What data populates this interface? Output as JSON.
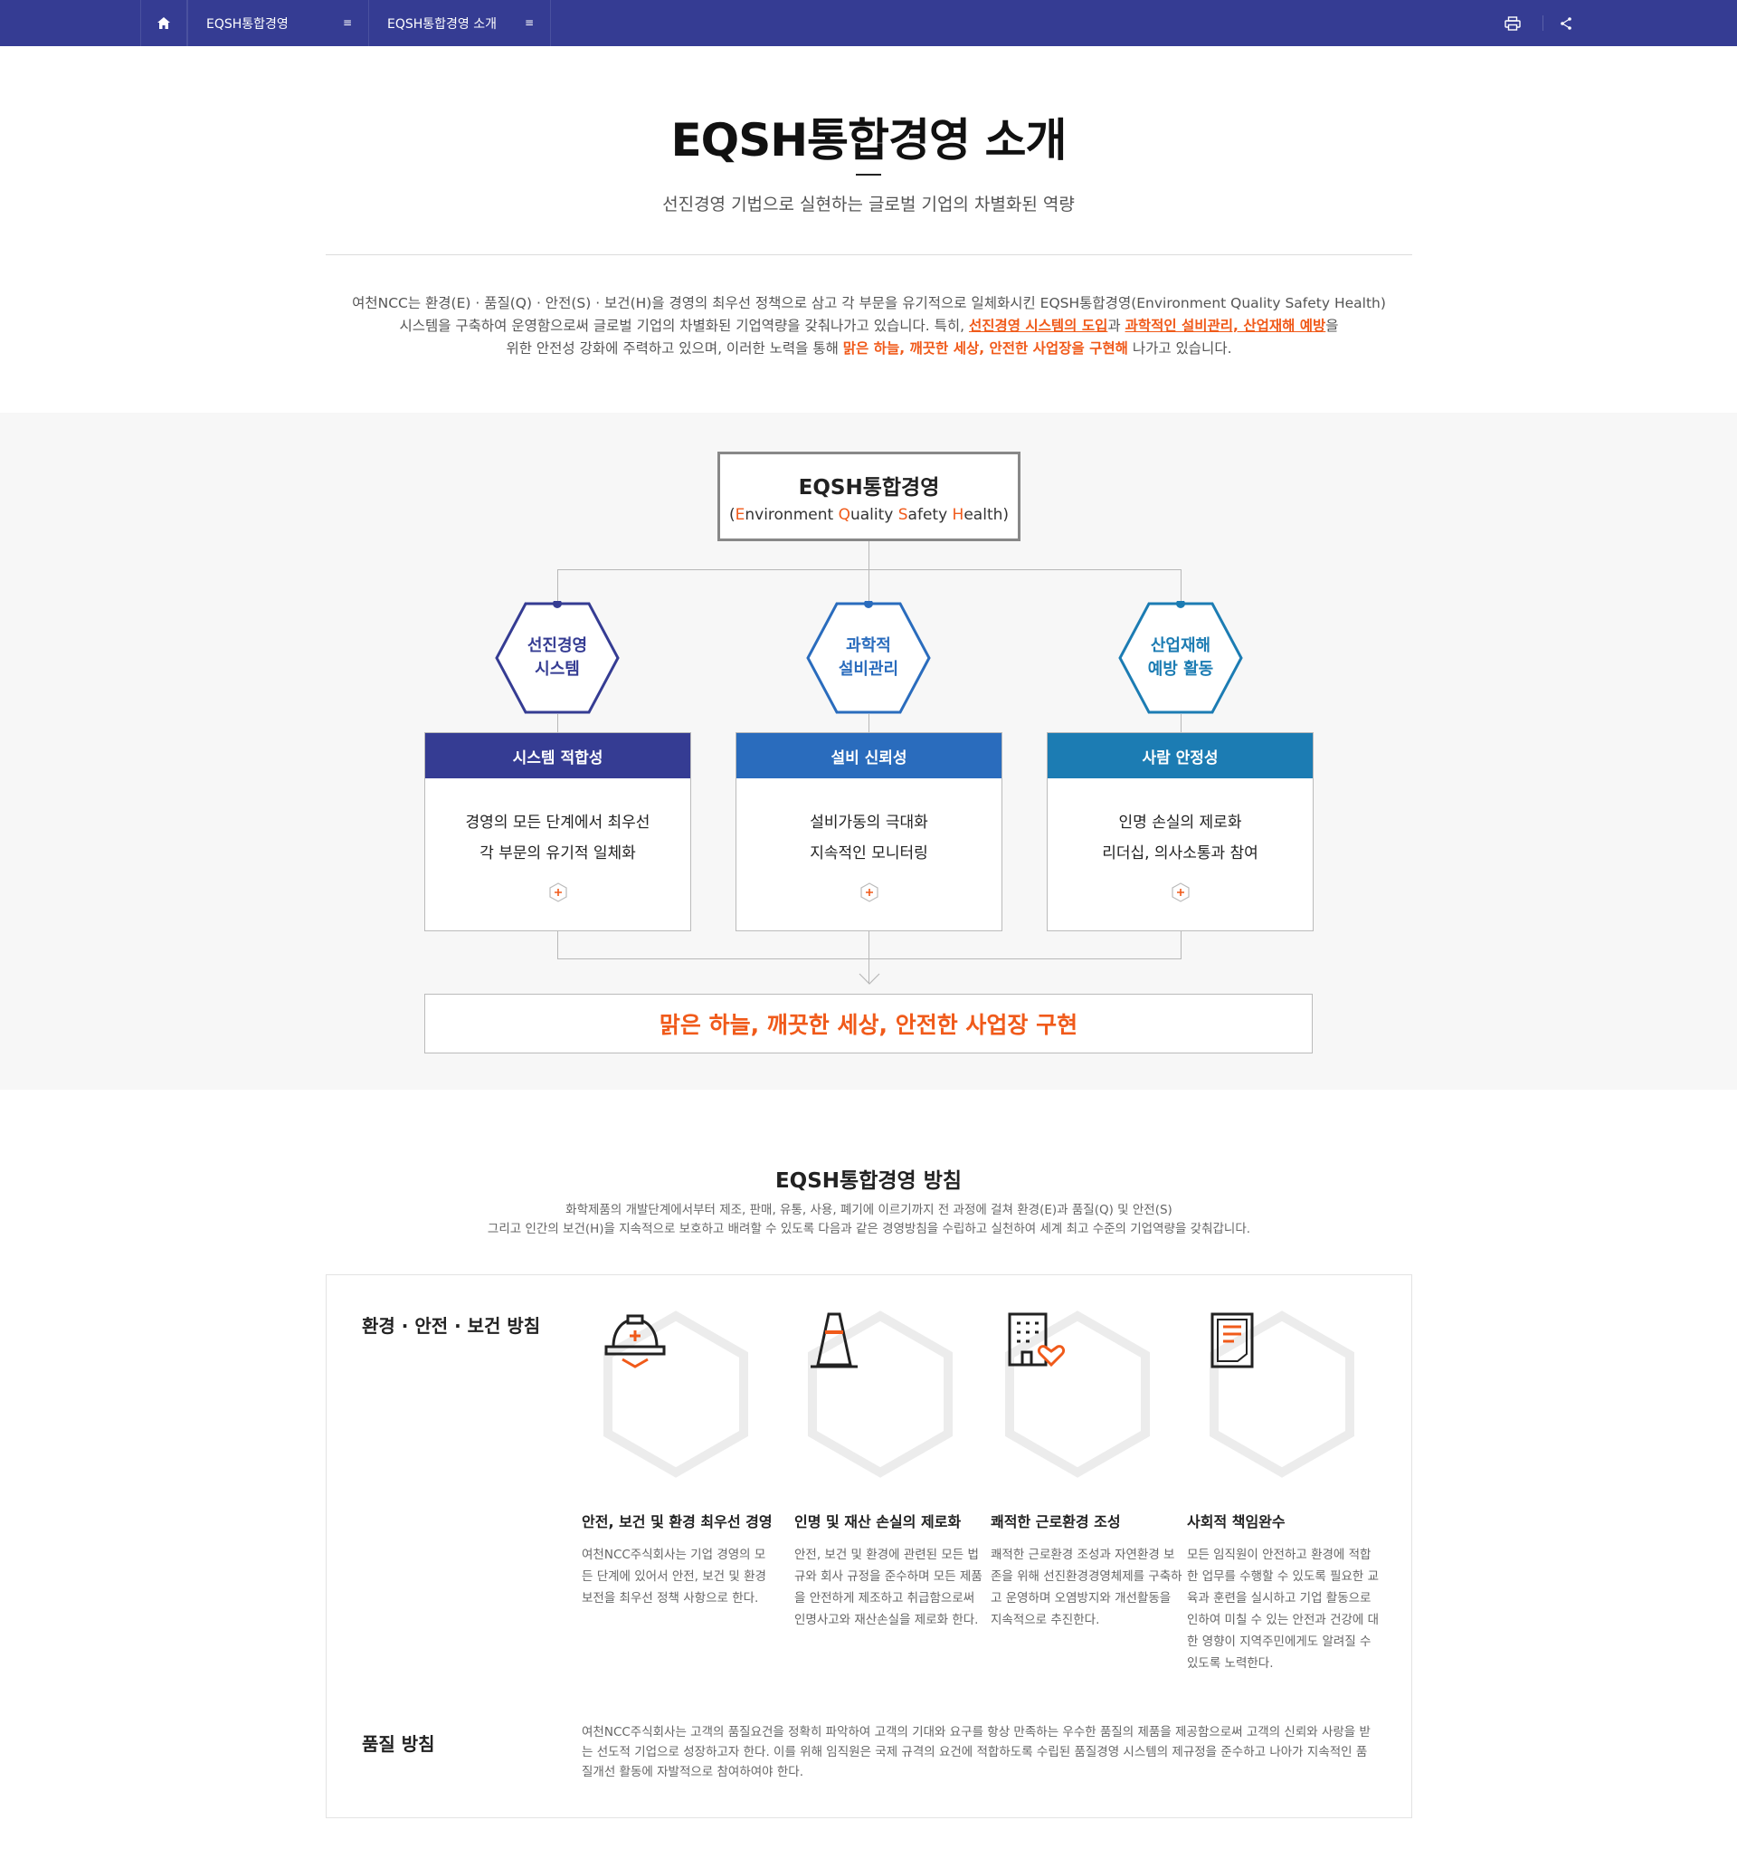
{
  "nav": {
    "crumb1": "EQSH통합경영",
    "crumb2": "EQSH통합경영 소개",
    "menu_glyph": "≡"
  },
  "header": {
    "title": "EQSH통합경영 소개",
    "subtitle": "선진경영 기법으로 실현하는 글로벌 기업의 차별화된 역량"
  },
  "intro": {
    "line1": "여천NCC는 환경(E) · 품질(Q) · 안전(S) · 보건(H)을 경영의 최우선 정책으로 삼고 각 부문을 유기적으로 일체화시킨 EQSH통합경영(Environment Quality Safety Health)",
    "line2_a": "시스템을 구축하여 운영함으로써 글로벌 기업의 차별화된 기업역량을 갖춰나가고 있습니다. 특히, ",
    "line2_hl1": "선진경영 시스템의 도입",
    "line2_b": "과 ",
    "line2_hl2": "과학적인 설비관리, 산업재해 예방",
    "line2_c": "을",
    "line3_a": "위한 안전성 강화에 주력하고 있으며, 이러한 노력을 통해 ",
    "line3_hl": "맑은 하늘, 깨끗한 세상, 안전한 사업장을 구현해",
    "line3_b": " 나가고 있습니다."
  },
  "diagram": {
    "top_title": "EQSH통합경영",
    "top_sub_parts": [
      "(",
      "E",
      "nvironment ",
      "Q",
      "uality ",
      "S",
      "afety ",
      "H",
      "ealth)"
    ],
    "pillars": [
      {
        "hex": "선진경영\n시스템",
        "head": "시스템 적합성",
        "line1": "경영의 모든 단계에서 최우선",
        "line2": "각 부문의 유기적 일체화",
        "color": "#353c93"
      },
      {
        "hex": "과학적\n설비관리",
        "head": "설비 신뢰성",
        "line1": "설비가동의 극대화",
        "line2": "지속적인 모니터링",
        "color": "#2a6cbd"
      },
      {
        "hex": "산업재해\n예방 활동",
        "head": "사람 안정성",
        "line1": "인명 손실의 제로화",
        "line2": "리더십, 의사소통과 참여",
        "color": "#1c7cb3"
      }
    ],
    "result": "맑은 하늘, 깨끗한 세상, 안전한 사업장 구현"
  },
  "policy": {
    "title": "EQSH통합경영 방침",
    "desc1": "화학제품의 개발단계에서부터 제조, 판매, 유통, 사용, 폐기에 이르기까지 전 과정에 걸쳐 환경(E)과 품질(Q) 및 안전(S)",
    "desc2": "그리고 인간의 보건(H)을 지속적으로 보호하고 배려할 수 있도록 다음과 같은 경영방침을 수립하고 실천하여 세계 최고 수준의 기업역량을 갖춰갑니다.",
    "env_title": "환경 · 안전 · 보건 방침",
    "items": [
      {
        "title": "안전, 보건 및 환경 최우선 경영",
        "body": "여천NCC주식회사는 기업 경영의 모든 단계에 있어서 안전, 보건 및 환경보전을 최우선 정책 사항으로 한다."
      },
      {
        "title": "인명 및 재산 손실의 제로화",
        "body": "안전, 보건 및 환경에 관련된 모든 법규와 회사 규정을 준수하며 모든 제품을 안전하게 제조하고 취급함으로써 인명사고와 재산손실을 제로화 한다."
      },
      {
        "title": "쾌적한 근로환경 조성",
        "body": "쾌적한 근로환경 조성과 자연환경 보존을 위해 선진환경경영체제를 구축하고 운영하며 오염방지와 개선활동을 지속적으로 추진한다."
      },
      {
        "title": "사회적 책임완수",
        "body": "모든 임직원이 안전하고 환경에 적합한 업무를 수행할 수 있도록 필요한 교육과 훈련을 실시하고 기업 활동으로 인하여 미칠 수 있는 안전과 건강에 대한 영향이 지역주민에게도 알려질 수 있도록 노력한다."
      }
    ],
    "quality_title": "품질 방침",
    "quality_text": "여천NCC주식회사는 고객의 품질요건을 정확히 파악하여 고객의 기대와 요구를 항상 만족하는 우수한 품질의 제품을 제공함으로써 고객의 신뢰와 사랑을 받는 선도적 기업으로 성장하고자 한다. 이를 위해 임직원은 국제 규격의 요건에 적합하도록 수립된 품질경영 시스템의 제규정을 준수하고 나아가 지속적인 품질개선 활동에 자발적으로 참여하여야 한다."
  },
  "colors": {
    "navy": "#353c93",
    "blue": "#2a6cbd",
    "teal": "#1c7cb3",
    "accent": "#f05a1a"
  },
  "icons": {
    "home": "home-icon",
    "print": "print-icon",
    "share": "share-icon",
    "plus": "plus-icon"
  }
}
